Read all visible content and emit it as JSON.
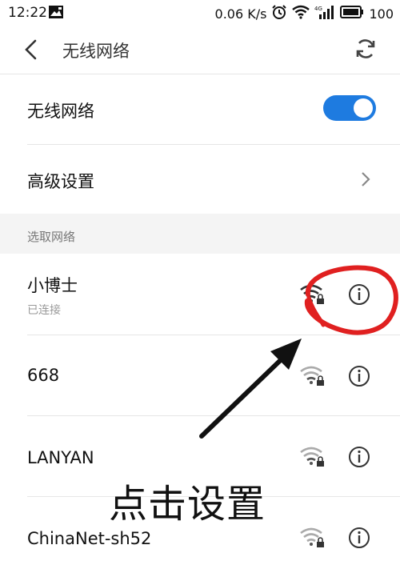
{
  "status_bar": {
    "time": "12:22",
    "speed": "0.06 K/s",
    "battery": "100",
    "network_type": "4G"
  },
  "header": {
    "title": "无线网络"
  },
  "wifi_toggle": {
    "label": "无线网络",
    "enabled": true
  },
  "advanced": {
    "label": "高级设置"
  },
  "section": {
    "label": "选取网络"
  },
  "networks": [
    {
      "ssid": "小博士",
      "status": "已连接"
    },
    {
      "ssid": "668",
      "status": ""
    },
    {
      "ssid": "LANYAN",
      "status": ""
    },
    {
      "ssid": "ChinaNet-sh52",
      "status": ""
    }
  ],
  "annotation": {
    "text": "点击设置"
  },
  "colors": {
    "accent": "#1e7be0",
    "annotation_red": "#e02020"
  }
}
